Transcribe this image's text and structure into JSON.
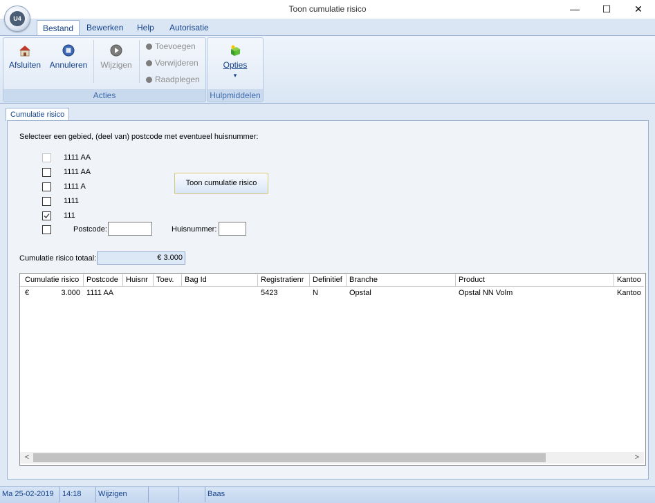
{
  "window": {
    "title": "Toon cumulatie risico",
    "minimize": "—",
    "maximize": "☐",
    "close": "✕",
    "logo": "U4"
  },
  "ribbon": {
    "tabs": [
      "Bestand",
      "Bewerken",
      "Help",
      "Autorisatie"
    ],
    "groups": {
      "acties": {
        "label": "Acties",
        "afsluiten": "Afsluiten",
        "annuleren": "Annuleren",
        "wijzigen": "Wijzigen",
        "toevoegen": "Toevoegen",
        "verwijderen": "Verwijderen",
        "raadplegen": "Raadplegen"
      },
      "hulpmiddelen": {
        "label": "Hulpmiddelen",
        "opties": "Opties",
        "opties_arrow": "▾"
      }
    }
  },
  "doc_tab": "Cumulatie risico",
  "form": {
    "instruction": "Selecteer een gebied, (deel van) postcode met eventueel huisnummer:",
    "options": [
      {
        "label": "1111 AA",
        "checked": false,
        "disabled": true
      },
      {
        "label": "1111 AA",
        "checked": false,
        "disabled": false
      },
      {
        "label": "1111 A",
        "checked": false,
        "disabled": false
      },
      {
        "label": "1111",
        "checked": false,
        "disabled": false
      },
      {
        "label": "111",
        "checked": true,
        "disabled": false
      }
    ],
    "postcode_label": "Postcode:",
    "postcode_value": "",
    "huisnummer_label": "Huisnummer:",
    "huisnummer_value": "",
    "toon_button": "Toon cumulatie risico",
    "totaal_label": "Cumulatie risico totaal:",
    "totaal_value": "€ 3.000"
  },
  "grid": {
    "columns": [
      "Cumulatie risico",
      "Postcode",
      "Huisnr",
      "Toev.",
      "Bag Id",
      "Registratienr",
      "Definitief",
      "Branche",
      "Product",
      "Kantoo"
    ],
    "rows": [
      {
        "currency": "€",
        "amount": "3.000",
        "postcode": "1111 AA",
        "huisnr": "",
        "toev": "",
        "bagid": "",
        "registratienr": "5423",
        "definitief": "N",
        "branche": "Opstal",
        "product": "Opstal NN Volm",
        "kantoor": "Kantoo"
      }
    ],
    "scroll_left": "<",
    "scroll_right": ">"
  },
  "status": {
    "date": "Ma 25-02-2019",
    "time": "14:18",
    "mode": "Wijzigen",
    "field4": "",
    "field5": "",
    "user": "Baas"
  },
  "colors": {
    "accent": "#15428b",
    "ribbon_label": "#3e6aaa",
    "status_bg": "#c3d6ef"
  }
}
